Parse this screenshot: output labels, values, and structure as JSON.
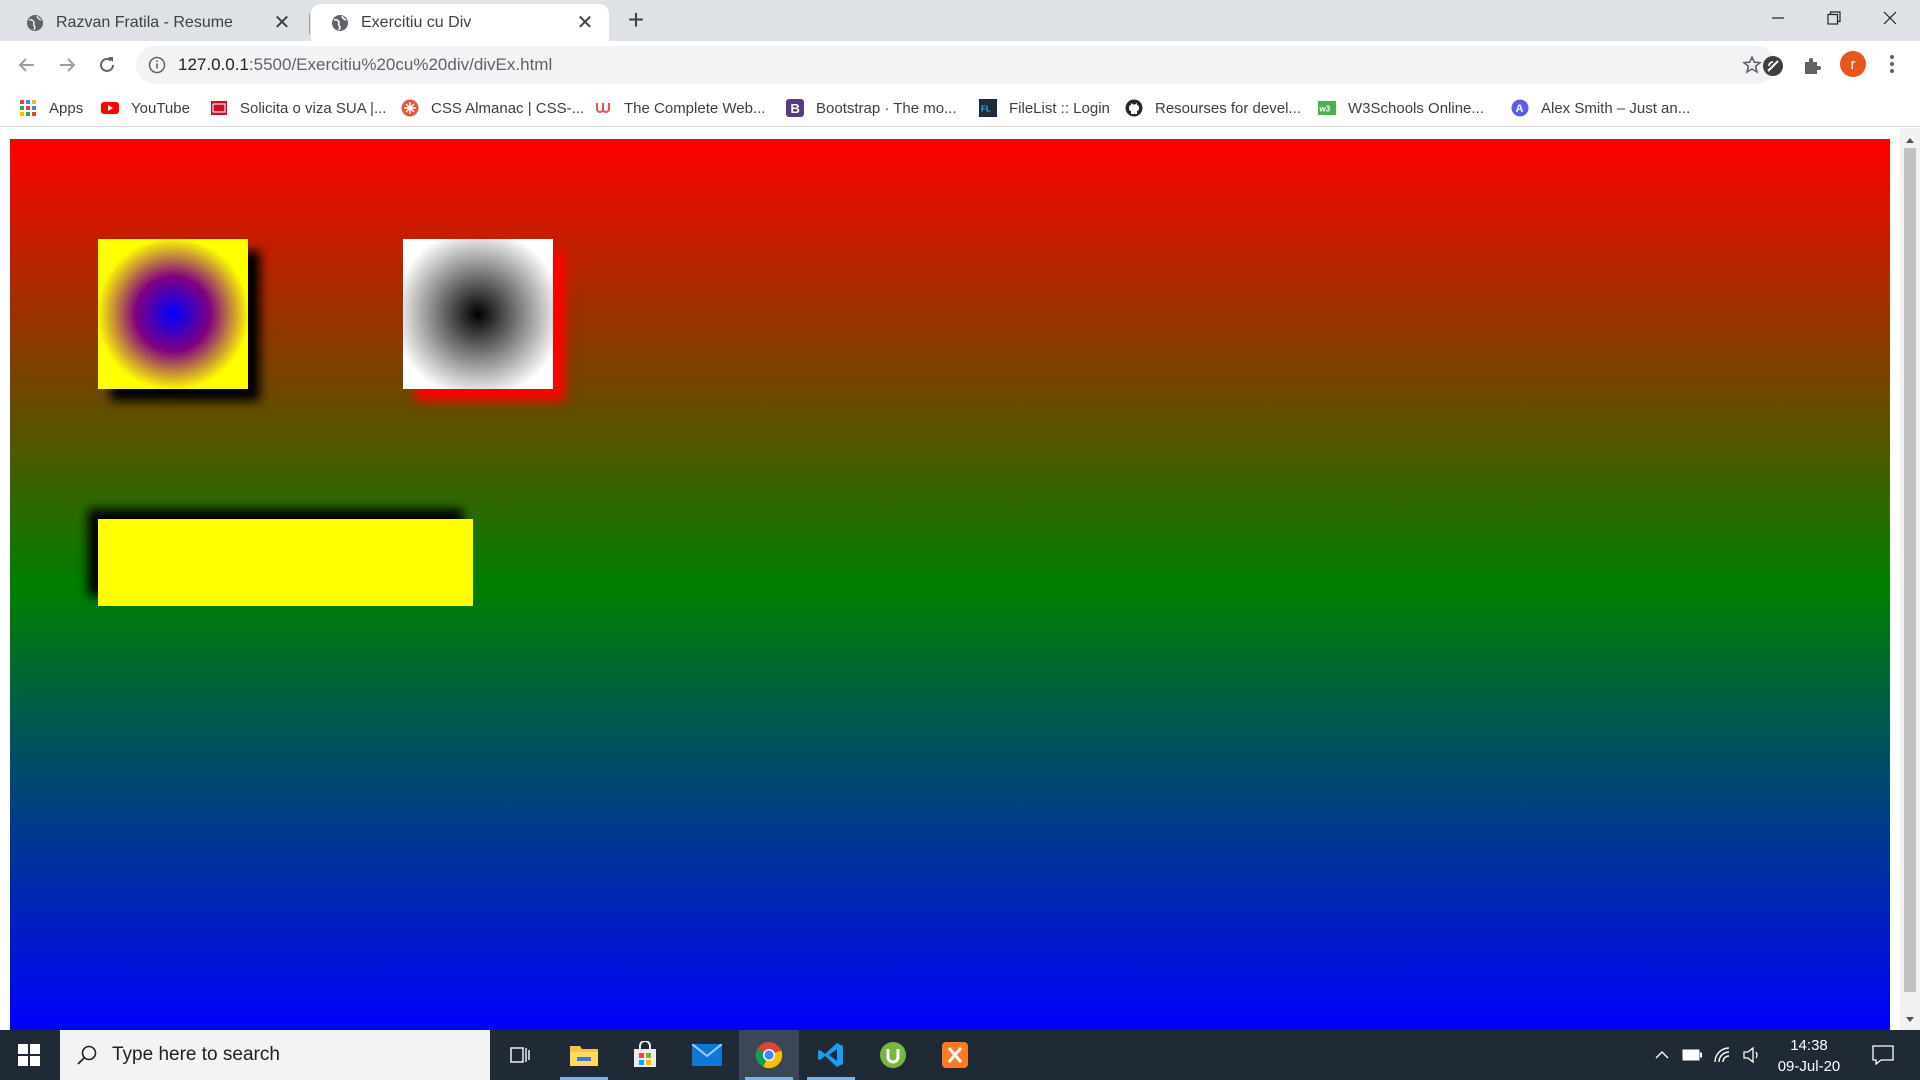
{
  "browser": {
    "tabs": [
      {
        "title": "Razvan Fratila - Resume",
        "active": false
      },
      {
        "title": "Exercitiu cu Div",
        "active": true
      }
    ],
    "new_tab_label": "+",
    "url_host": "127.0.0.1",
    "url_rest": ":5500/Exercitiu%20cu%20div/divEx.html",
    "profile_initial": "r",
    "bookmarks": [
      {
        "label": "Apps",
        "icon": "apps-grid-icon"
      },
      {
        "label": "YouTube",
        "icon": "youtube-icon"
      },
      {
        "label": "Solicita o viza SUA |...",
        "icon": "cgi-icon"
      },
      {
        "label": "CSS Almanac | CSS-...",
        "icon": "css-tricks-icon"
      },
      {
        "label": "The Complete Web...",
        "icon": "udemy-icon"
      },
      {
        "label": "Bootstrap · The mo...",
        "icon": "bootstrap-icon"
      },
      {
        "label": "FileList :: Login",
        "icon": "filelist-icon"
      },
      {
        "label": "Resourses for devel...",
        "icon": "github-icon"
      },
      {
        "label": "W3Schools Online...",
        "icon": "w3schools-icon"
      },
      {
        "label": "Alex Smith – Just an...",
        "icon": "alex-smith-icon"
      }
    ]
  },
  "page": {
    "background_colors": [
      "#ff0000",
      "#008000",
      "#0000ff"
    ],
    "boxes": [
      {
        "name": "radial-yellow-box",
        "colors": [
          "#0000ff",
          "#800080",
          "#ffff00"
        ],
        "shadow": "#000000"
      },
      {
        "name": "radial-gray-box",
        "colors": [
          "#000000",
          "#808080",
          "#ffffff"
        ],
        "shadow": "#ff0000"
      },
      {
        "name": "yellow-rectangle",
        "colors": [
          "#ffff00"
        ],
        "shadow": "#000000"
      }
    ]
  },
  "taskbar": {
    "search_placeholder": "Type here to search",
    "time": "14:38",
    "date": "09-Jul-20",
    "pinned": [
      "task-view-icon",
      "file-explorer-icon",
      "store-icon",
      "mail-icon",
      "chrome-icon",
      "vscode-icon",
      "utorrent-icon",
      "xampp-icon"
    ]
  }
}
